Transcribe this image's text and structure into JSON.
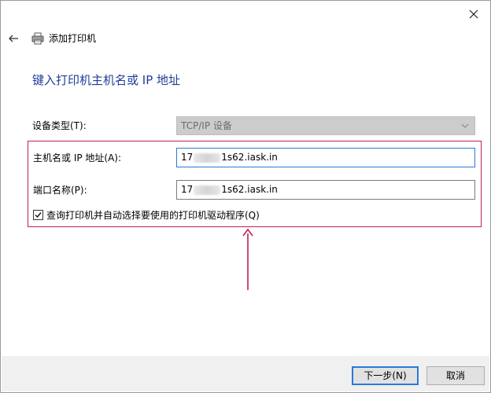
{
  "window": {
    "title": "添加打印机"
  },
  "page": {
    "heading": "键入打印机主机名或 IP 地址"
  },
  "form": {
    "device_type": {
      "label": "设备类型(T):",
      "value": "TCP/IP 设备"
    },
    "host": {
      "label": "主机名或 IP 地址(A):",
      "value_prefix": "17",
      "value_suffix": "1s62.iask.in"
    },
    "port": {
      "label": "端口名称(P):",
      "value_prefix": "17",
      "value_suffix": "1s62.iask.in"
    },
    "query_driver": {
      "label": "查询打印机并自动选择要使用的打印机驱动程序(Q)",
      "checked": true
    }
  },
  "buttons": {
    "next": "下一步(N)",
    "cancel": "取消"
  },
  "icons": {
    "close": "close-icon",
    "back": "back-arrow-icon",
    "printer": "printer-icon",
    "chevron": "chevron-down-icon",
    "checkmark": "checkmark-icon",
    "annotation_arrow": "arrow-up-icon"
  },
  "colors": {
    "heading": "#1f3d99",
    "highlight": "#c21d5b",
    "focus": "#2b79d7"
  }
}
